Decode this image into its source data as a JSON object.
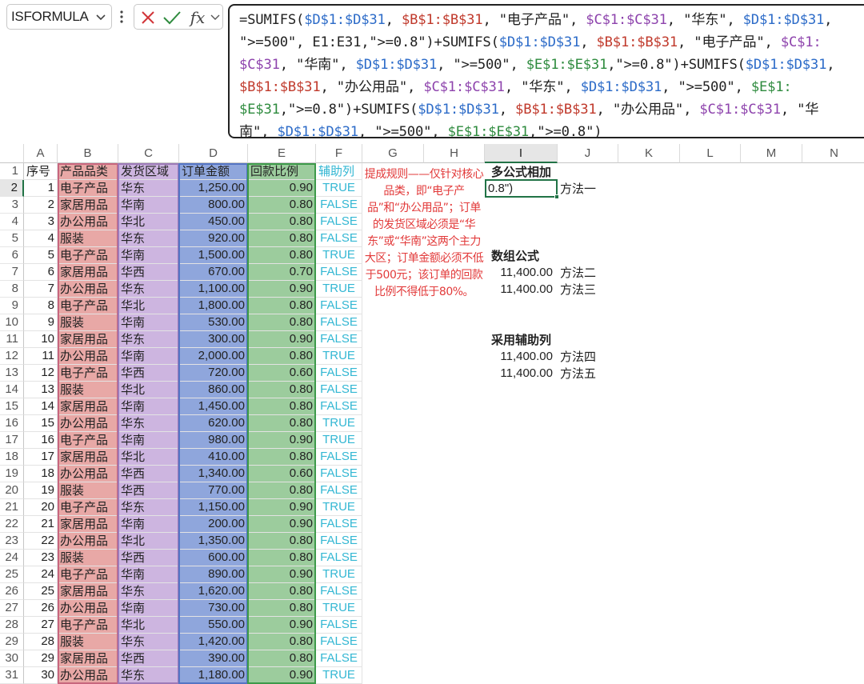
{
  "formula_bar": {
    "name_box": "ISFORMULA",
    "fx_label": "fx",
    "formula_parts": [
      {
        "t": "=SUMIFS(",
        "c": ""
      },
      {
        "t": "$D$1:$D$31",
        "c": "f-blue"
      },
      {
        "t": ", ",
        "c": ""
      },
      {
        "t": "$B$1:$B$31",
        "c": "f-red"
      },
      {
        "t": ", \"电子产品\", ",
        "c": ""
      },
      {
        "t": "$C$1:$C$31",
        "c": "f-purple"
      },
      {
        "t": ", \"华东\", ",
        "c": ""
      },
      {
        "t": "$D$1:$D$31",
        "c": "f-blue"
      },
      {
        "t": ",\n\">=500\", E1:E31,\">=0.8\")+SUMIFS(",
        "c": ""
      },
      {
        "t": "$D$1:$D$31",
        "c": "f-blue"
      },
      {
        "t": ", ",
        "c": ""
      },
      {
        "t": "$B$1:$B$31",
        "c": "f-red"
      },
      {
        "t": ", \"电子产品\", ",
        "c": ""
      },
      {
        "t": "$C$1:\n$C$31",
        "c": "f-purple"
      },
      {
        "t": ", \"华南\", ",
        "c": ""
      },
      {
        "t": "$D$1:$D$31",
        "c": "f-blue"
      },
      {
        "t": ", \">=500\", ",
        "c": ""
      },
      {
        "t": "$E$1:$E$31",
        "c": "f-green"
      },
      {
        "t": ",\">=0.8\")+SUMIFS(",
        "c": ""
      },
      {
        "t": "$D$1:$D$31",
        "c": "f-blue"
      },
      {
        "t": ",\n",
        "c": ""
      },
      {
        "t": "$B$1:$B$31",
        "c": "f-red"
      },
      {
        "t": ", \"办公用品\", ",
        "c": ""
      },
      {
        "t": "$C$1:$C$31",
        "c": "f-purple"
      },
      {
        "t": ", \"华东\", ",
        "c": ""
      },
      {
        "t": "$D$1:$D$31",
        "c": "f-blue"
      },
      {
        "t": ", \">=500\", ",
        "c": ""
      },
      {
        "t": "$E$1:\n$E$31",
        "c": "f-green"
      },
      {
        "t": ",\">=0.8\")+SUMIFS(",
        "c": ""
      },
      {
        "t": "$D$1:$D$31",
        "c": "f-blue"
      },
      {
        "t": ", ",
        "c": ""
      },
      {
        "t": "$B$1:$B$31",
        "c": "f-red"
      },
      {
        "t": ", \"办公用品\", ",
        "c": ""
      },
      {
        "t": "$C$1:$C$31",
        "c": "f-purple"
      },
      {
        "t": ", \"华\n南\", ",
        "c": ""
      },
      {
        "t": "$D$1:$D$31",
        "c": "f-blue"
      },
      {
        "t": ", \">=500\", ",
        "c": ""
      },
      {
        "t": "$E$1:$E$31",
        "c": "f-green"
      },
      {
        "t": ",\">=0.8\")",
        "c": ""
      }
    ]
  },
  "columns": [
    "A",
    "B",
    "C",
    "D",
    "E",
    "F",
    "G",
    "H",
    "I",
    "J",
    "K",
    "L",
    "M",
    "N"
  ],
  "headers": {
    "A": "序号",
    "B": "产品品类",
    "C": "发货区域",
    "D": "订单金额",
    "E": "回款比例",
    "F": "辅助列"
  },
  "rows": [
    [
      1,
      "电子产品",
      "华东",
      "1,250.00",
      "0.90",
      "TRUE"
    ],
    [
      2,
      "家居用品",
      "华南",
      "800.00",
      "0.80",
      "FALSE"
    ],
    [
      3,
      "办公用品",
      "华北",
      "450.00",
      "0.80",
      "FALSE"
    ],
    [
      4,
      "服装",
      "华东",
      "920.00",
      "0.80",
      "FALSE"
    ],
    [
      5,
      "电子产品",
      "华南",
      "1,500.00",
      "0.80",
      "TRUE"
    ],
    [
      6,
      "家居用品",
      "华西",
      "670.00",
      "0.70",
      "FALSE"
    ],
    [
      7,
      "办公用品",
      "华东",
      "1,100.00",
      "0.90",
      "TRUE"
    ],
    [
      8,
      "电子产品",
      "华北",
      "1,800.00",
      "0.80",
      "FALSE"
    ],
    [
      9,
      "服装",
      "华南",
      "530.00",
      "0.80",
      "FALSE"
    ],
    [
      10,
      "家居用品",
      "华东",
      "300.00",
      "0.90",
      "FALSE"
    ],
    [
      11,
      "办公用品",
      "华南",
      "2,000.00",
      "0.80",
      "TRUE"
    ],
    [
      12,
      "电子产品",
      "华西",
      "720.00",
      "0.60",
      "FALSE"
    ],
    [
      13,
      "服装",
      "华北",
      "860.00",
      "0.80",
      "FALSE"
    ],
    [
      14,
      "家居用品",
      "华南",
      "1,450.00",
      "0.80",
      "FALSE"
    ],
    [
      15,
      "办公用品",
      "华东",
      "620.00",
      "0.80",
      "TRUE"
    ],
    [
      16,
      "电子产品",
      "华南",
      "980.00",
      "0.90",
      "TRUE"
    ],
    [
      17,
      "家居用品",
      "华北",
      "410.00",
      "0.80",
      "FALSE"
    ],
    [
      18,
      "办公用品",
      "华西",
      "1,340.00",
      "0.60",
      "FALSE"
    ],
    [
      19,
      "服装",
      "华西",
      "770.00",
      "0.80",
      "FALSE"
    ],
    [
      20,
      "电子产品",
      "华东",
      "1,150.00",
      "0.90",
      "TRUE"
    ],
    [
      21,
      "家居用品",
      "华南",
      "200.00",
      "0.90",
      "FALSE"
    ],
    [
      22,
      "办公用品",
      "华北",
      "1,350.00",
      "0.80",
      "FALSE"
    ],
    [
      23,
      "服装",
      "华西",
      "600.00",
      "0.80",
      "FALSE"
    ],
    [
      24,
      "电子产品",
      "华南",
      "890.00",
      "0.90",
      "TRUE"
    ],
    [
      25,
      "家居用品",
      "华东",
      "1,620.00",
      "0.80",
      "FALSE"
    ],
    [
      26,
      "办公用品",
      "华南",
      "730.00",
      "0.80",
      "TRUE"
    ],
    [
      27,
      "电子产品",
      "华北",
      "550.00",
      "0.90",
      "FALSE"
    ],
    [
      28,
      "服装",
      "华东",
      "1,420.00",
      "0.80",
      "FALSE"
    ],
    [
      29,
      "家居用品",
      "华西",
      "390.00",
      "0.80",
      "FALSE"
    ],
    [
      30,
      "办公用品",
      "华东",
      "1,180.00",
      "0.90",
      "TRUE"
    ]
  ],
  "note": "提成规则——仅针对核心品类，即“电子产品”和“办公用品”；订单的发货区域必须是“华东”或“华南”这两个主力大区；订单金额必须不低于500元；该订单的回款比例不得低于80%。",
  "side": {
    "title1": "多公式相加",
    "active_cell_text": "0.8\")",
    "method1": "方法一",
    "title2": "数组公式",
    "val2": "11,400.00",
    "method2": "方法二",
    "val3": "11,400.00",
    "method3": "方法三",
    "title3": "采用辅助列",
    "val4": "11,400.00",
    "method4": "方法四",
    "val5": "11,400.00",
    "method5": "方法五"
  }
}
